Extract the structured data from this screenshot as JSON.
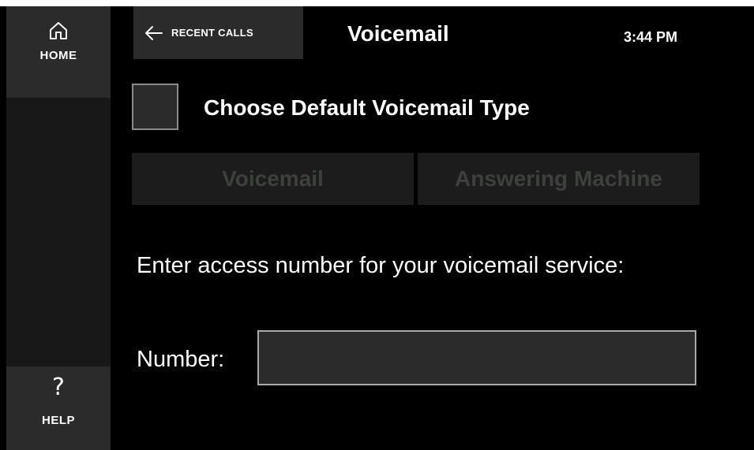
{
  "sidebar": {
    "home": {
      "label": "HOME",
      "icon": "home-icon"
    },
    "help": {
      "label": "HELP",
      "icon": "question-mark-icon",
      "glyph": "?"
    }
  },
  "header": {
    "back": {
      "label": "RECENT CALLS",
      "icon": "arrow-left-icon"
    },
    "title": "Voicemail",
    "time": "3:44 PM"
  },
  "settings": {
    "default_type": {
      "label": "Choose Default Voicemail Type",
      "checked": false
    },
    "options": [
      {
        "label": "Voicemail",
        "enabled": false
      },
      {
        "label": "Answering Machine",
        "enabled": false
      }
    ],
    "instructions": "Enter access number for your voicemail service:",
    "number": {
      "label": "Number:",
      "value": "",
      "placeholder": ""
    }
  },
  "colors": {
    "background": "#000000",
    "panel": "#2a2b2a",
    "disabled_text": "#3e403e",
    "text": "#ffffff"
  }
}
